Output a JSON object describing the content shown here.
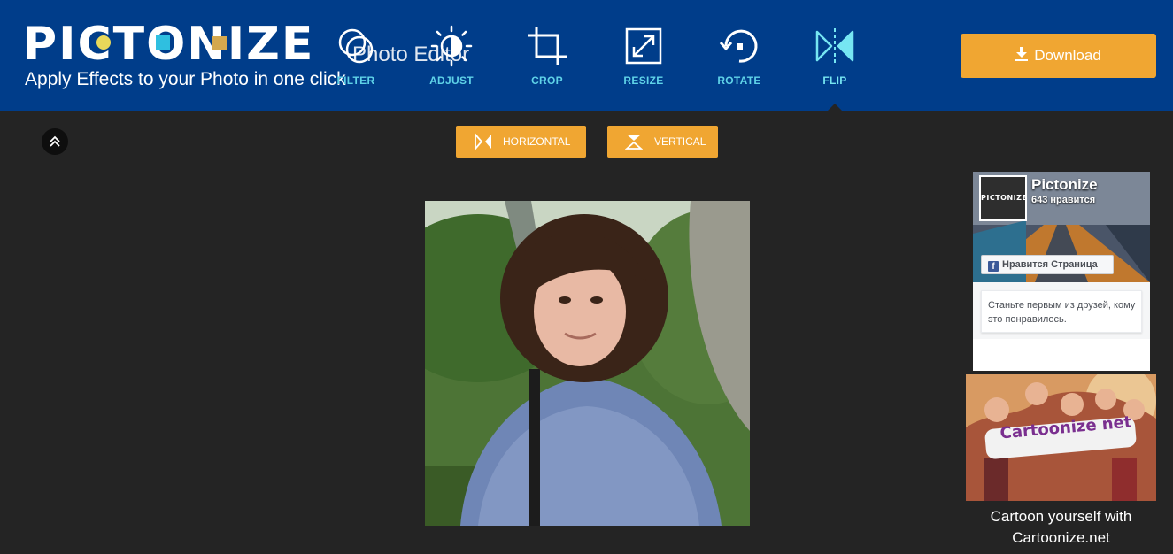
{
  "brand": {
    "logo_text": "PICTONIZE",
    "tagline": "Apply Effects to your Photo in one click",
    "overlay_title": "Photo Editor"
  },
  "toolbar": {
    "items": [
      {
        "label": "FILTER",
        "icon": "filter-icon"
      },
      {
        "label": "ADJUST",
        "icon": "adjust-icon"
      },
      {
        "label": "CROP",
        "icon": "crop-icon"
      },
      {
        "label": "RESIZE",
        "icon": "resize-icon"
      },
      {
        "label": "ROTATE",
        "icon": "rotate-icon"
      },
      {
        "label": "FLIP",
        "icon": "flip-icon"
      }
    ],
    "active": "FLIP"
  },
  "download": {
    "label": "Download",
    "icon": "download-icon"
  },
  "flip_options": {
    "horizontal": "HORIZONTAL",
    "vertical": "VERTICAL"
  },
  "facebook_widget": {
    "page_name": "Pictonize",
    "likes": "643 нравится",
    "like_button": "Нравится Страница",
    "friends_text": "Станьте первым из друзей, кому это понравилось.",
    "avatar_text": "PICTONIZE"
  },
  "ad": {
    "banner_text": "Cartoonize net",
    "caption": "Cartoon yourself with Cartoonize.net"
  },
  "colors": {
    "header_bg": "#003d8a",
    "page_bg": "#242424",
    "accent_orange": "#f0a632",
    "tool_label": "#5fd3e8"
  }
}
